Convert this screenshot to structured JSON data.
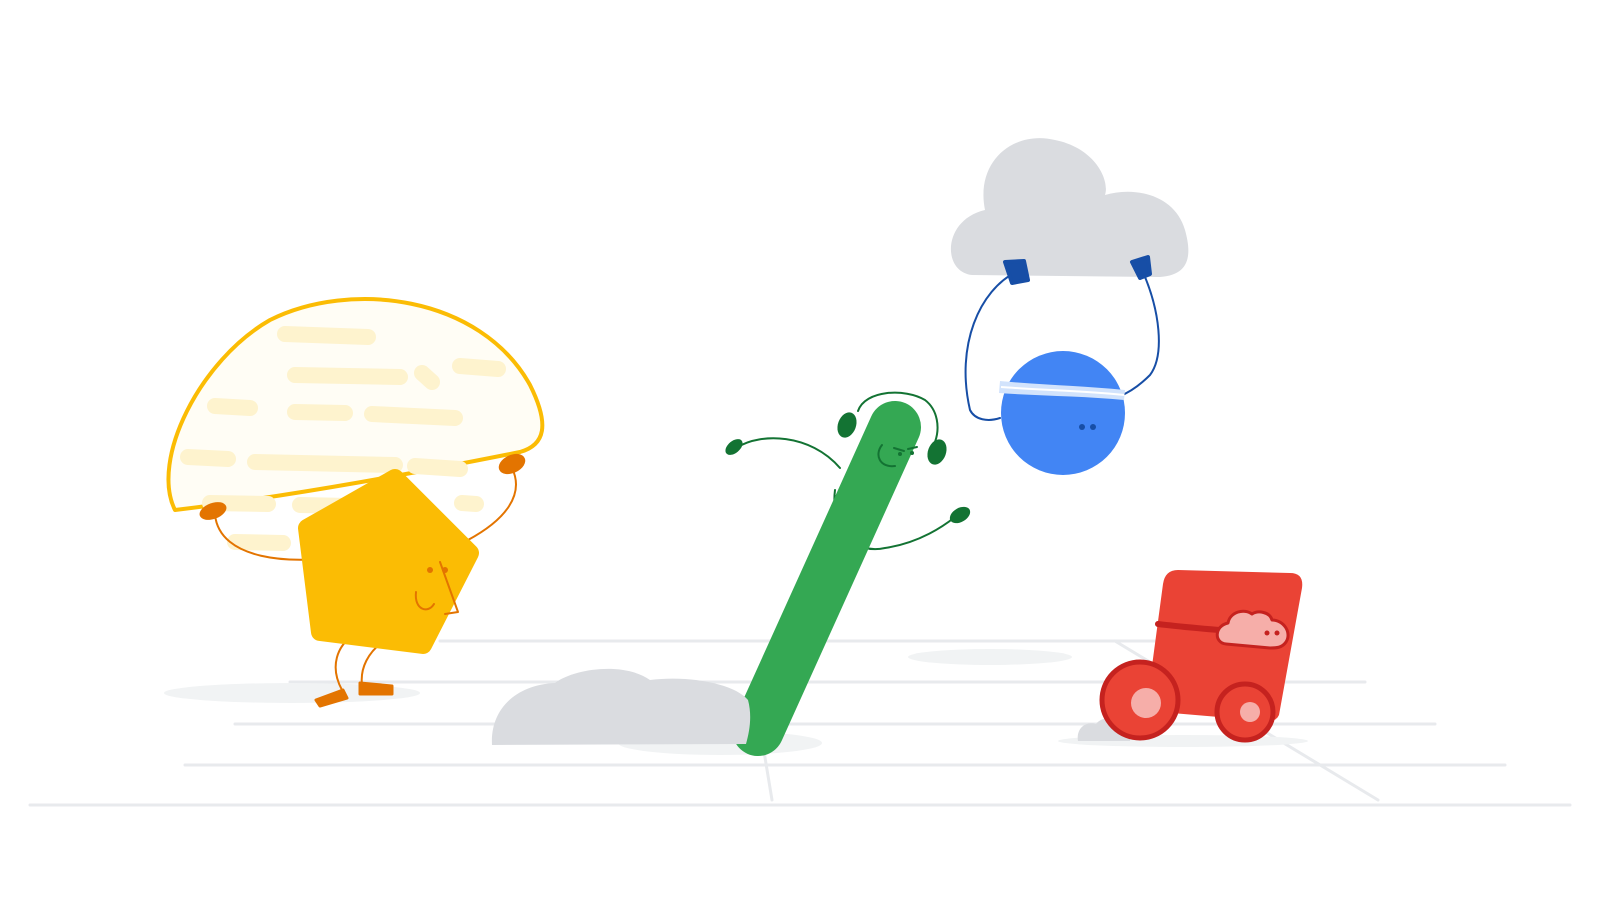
{
  "scene": {
    "subjects": [
      {
        "name": "yellow-pentagon-character",
        "action": "jump-rope",
        "color": "#FBBC04"
      },
      {
        "name": "green-bar-character",
        "action": "pole-vault",
        "color": "#34A853"
      },
      {
        "name": "blue-circle-character",
        "action": "cloud-rope-swing",
        "color": "#4285F4"
      },
      {
        "name": "red-block-character",
        "action": "riding-wheels",
        "color": "#EA4335"
      }
    ],
    "colors": {
      "yellow": "#FBBC04",
      "yellow_light": "#FEF3CE",
      "orange": "#E37400",
      "green": "#34A853",
      "green_dark": "#137333",
      "blue": "#4285F4",
      "blue_dark": "#174EA6",
      "blue_band": "#D2E3FC",
      "red": "#EA4335",
      "red_dark": "#C5221F",
      "pink": "#F6AEA9",
      "cloud_grey": "#DADCE0",
      "floor_line": "#E8EAED",
      "shadow": "#F1F3F4"
    }
  }
}
